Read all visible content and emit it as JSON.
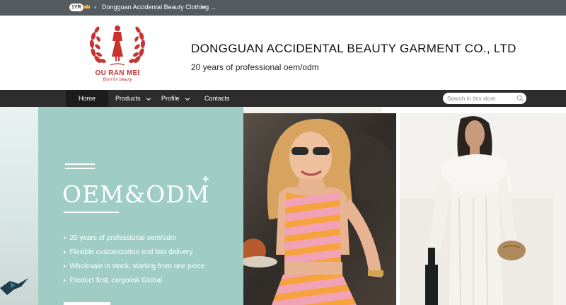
{
  "topbar": {
    "years_badge": "1YR",
    "company_name": "Dongguan Accidental Beauty Clothing ...",
    "icons": [
      "crown-icon",
      "dot-icon",
      "chevron-down-icon"
    ]
  },
  "header": {
    "logo_name": "OU RAN MEI",
    "logo_slogan": "Born for beauty",
    "title": "DONGGUAN ACCIDENTAL BEAUTY GARMENT CO., LTD",
    "subtitle": "20 years of professional oem/odm"
  },
  "nav": {
    "items": [
      {
        "label": "Home",
        "active": true
      },
      {
        "label": "Products",
        "dropdown": true
      },
      {
        "label": "Profile",
        "dropdown": true
      },
      {
        "label": "Contacts"
      }
    ],
    "search_placeholder": "Search in this store"
  },
  "banner": {
    "heading": "OEM&ODM",
    "plus": "+",
    "bullets": [
      "20 years of professional oem/odm",
      "Flexible customization and fast delivery",
      "Wholesale in stock, starting from one piece",
      "Product first, cargolink Global"
    ],
    "colors": {
      "panel": "#9fcdc5",
      "accent": "#c8332f"
    }
  }
}
